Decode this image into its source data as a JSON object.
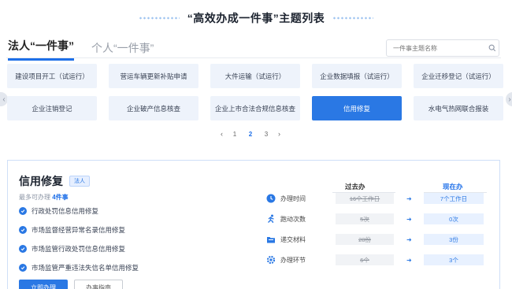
{
  "page_title": "“高效办成一件事”主题列表",
  "tabs": [
    {
      "label": "法人“一件事”",
      "active": true
    },
    {
      "label": "个人“一件事”",
      "active": false
    }
  ],
  "search": {
    "placeholder": "一件事主题名称"
  },
  "grid": [
    {
      "label": "建设项目开工（试运行）"
    },
    {
      "label": "营运车辆更新补贴申请"
    },
    {
      "label": "大件运输（试运行）"
    },
    {
      "label": "企业数据填报（试运行）"
    },
    {
      "label": "企业迁移登记（试运行）"
    },
    {
      "label": "企业注销登记"
    },
    {
      "label": "企业破产信息核查"
    },
    {
      "label": "企业上市合法合规信息核查"
    },
    {
      "label": "信用修复",
      "active": true
    },
    {
      "label": "水电气热网联合报装"
    }
  ],
  "pagination": {
    "prev": "‹",
    "pages": [
      "1",
      "2",
      "3"
    ],
    "current": "2",
    "next": "›"
  },
  "detail": {
    "title": "信用修复",
    "tag": "法人",
    "subtitle_prefix": "最多可办理",
    "subtitle_count": "4件事",
    "items": [
      "行政处罚信息信用修复",
      "市场监督经营异常名录信用修复",
      "市场监管行政处罚信息信用修复",
      "市场监管严重违法失信名单信用修复"
    ],
    "buttons": {
      "apply": "立即办理",
      "guide": "办事指南"
    },
    "compare": {
      "old_header": "过去办",
      "new_header": "现在办",
      "rows": [
        {
          "icon": "clock-icon",
          "label": "办理时间",
          "old": "16个工作日",
          "new": "7个工作日"
        },
        {
          "icon": "runner-icon",
          "label": "跑动次数",
          "old": "5次",
          "new": "0次"
        },
        {
          "icon": "folder-icon",
          "label": "递交材料",
          "old": "28份",
          "new": "3份"
        },
        {
          "icon": "gear-icon",
          "label": "办理环节",
          "old": "6个",
          "new": "3个"
        }
      ]
    }
  },
  "colors": {
    "accent": "#2a78e4",
    "cell_bg": "#eef3fb"
  }
}
